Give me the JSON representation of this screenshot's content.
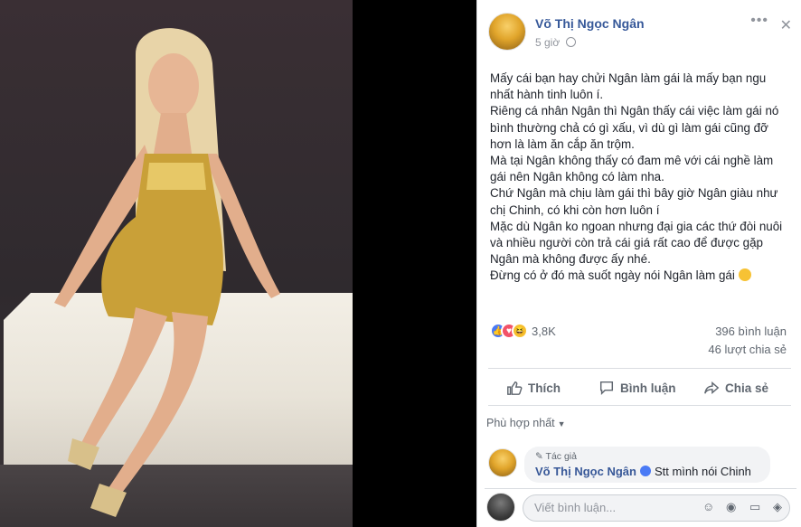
{
  "post": {
    "author": "Võ Thị Ngọc Ngân",
    "time": "5 giờ",
    "body": [
      "Mấy cái bạn hay chửi Ngân làm gái là mấy bạn ngu nhất hành tinh luôn í.",
      "Riêng cá nhân Ngân thì Ngân thấy cái việc làm gái nó bình thường chả có gì xấu, vì dù gì làm gái cũng đỡ hơn là làm ăn cắp ăn trộm.",
      "Mà tại Ngân không thấy có đam mê với cái nghề làm gái nên Ngân không có làm nha.",
      "Chứ Ngân mà chịu làm gái thì bây giờ Ngân giàu như chị Chinh, có khi còn hơn luôn í",
      "Mặc dù Ngân ko ngoan nhưng đại gia các thứ đòi nuôi và nhiều người còn trả cái giá rất cao để được gặp Ngân mà không được ấy nhé.",
      "Đừng có ở đó mà suốt ngày nói Ngân làm gái"
    ],
    "reactions_count": "3,8K",
    "comments_count": "396 bình luận",
    "shares_count": "46 lượt chia sẻ"
  },
  "actions": {
    "like": "Thích",
    "comment": "Bình luận",
    "share": "Chia sẻ"
  },
  "sort_label": "Phù hợp nhất",
  "top_comment": {
    "badge": "Tác giả",
    "author": "Võ Thị Ngọc Ngân",
    "text": "Stt mình nói Chinh"
  },
  "composer": {
    "placeholder": "Viết bình luận..."
  },
  "icons": {
    "close": "close-icon",
    "more": "more-icon",
    "globe": "globe-icon",
    "like": "like-icon",
    "comment": "comment-icon",
    "share": "share-icon",
    "emoji": "emoji-icon",
    "camera": "camera-icon",
    "gif": "gif-icon",
    "sticker": "sticker-icon"
  },
  "colors": {
    "link_blue": "#365899",
    "text": "#1d2129",
    "muted": "#606770"
  }
}
